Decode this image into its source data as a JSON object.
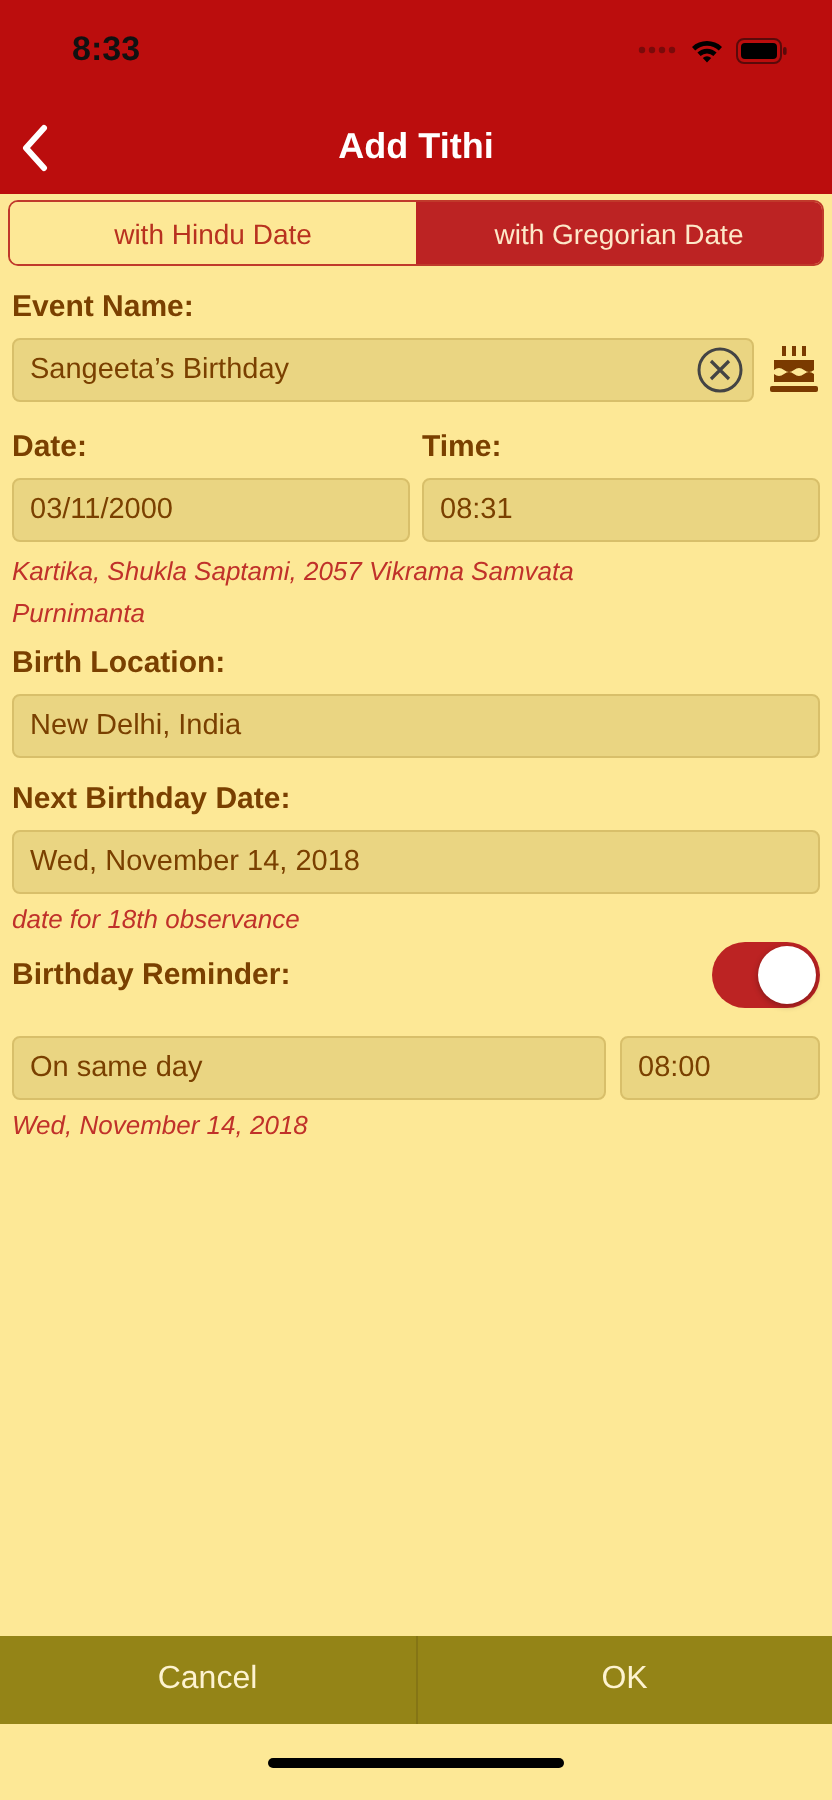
{
  "status_bar": {
    "time": "8:33"
  },
  "nav": {
    "title": "Add Tithi"
  },
  "tabs": [
    {
      "label": "with Hindu Date",
      "selected": false
    },
    {
      "label": "with Gregorian Date",
      "selected": true
    }
  ],
  "event_name": {
    "label": "Event Name:",
    "value": "Sangeeta’s Birthday"
  },
  "date": {
    "label": "Date:",
    "value": "03/11/2000"
  },
  "time": {
    "label": "Time:",
    "value": "08:31"
  },
  "hindu_date_note": [
    "Kartika, Shukla Saptami, 2057 Vikrama Samvata",
    "Purnimanta"
  ],
  "birth_location": {
    "label": "Birth Location:",
    "value": "New Delhi, India"
  },
  "next_birthday": {
    "label": "Next Birthday Date:",
    "value": "Wed, November 14, 2018",
    "note": "date for 18th observance"
  },
  "reminder": {
    "label": "Birthday Reminder:",
    "on": true,
    "when": "On same day",
    "time": "08:00",
    "note": "Wed, November 14, 2018"
  },
  "buttons": [
    "Cancel",
    "OK"
  ]
}
